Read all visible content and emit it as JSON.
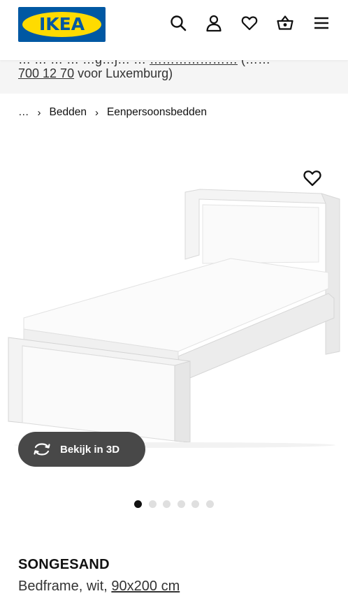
{
  "header": {
    "logo_text": "IKEA",
    "icons": [
      "search-icon",
      "account-icon",
      "heart-icon",
      "basket-icon",
      "menu-icon"
    ]
  },
  "banner": {
    "top_fragment_1": "… … … … …g…j… …",
    "top_link": "…………………",
    "top_fragment_2": "(……",
    "bottom_link": "700 12 70",
    "bottom_text": " voor Luxemburg)"
  },
  "breadcrumb": {
    "items": [
      "…",
      "Bedden",
      "Eenpersoonsbedden"
    ],
    "separator": "›"
  },
  "gallery": {
    "view_3d_label": "Bekijk in 3D",
    "total_images": 6,
    "active_index": 0
  },
  "product": {
    "name": "SONGESAND",
    "description": "Bedframe, wit, ",
    "size_link": "90x200 cm"
  },
  "colors": {
    "ikea_blue": "#0058a3",
    "ikea_yellow": "#ffdb00",
    "button_dark": "#484848",
    "banner_bg": "#f5f5f5"
  }
}
